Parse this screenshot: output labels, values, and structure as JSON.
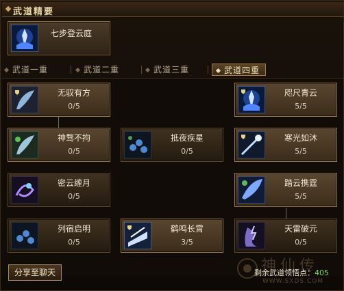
{
  "header": {
    "title": "武道精要"
  },
  "essence": {
    "label": "七步登云庭",
    "icon": "lotus-warrior-icon"
  },
  "tabs": [
    {
      "label": "武道一重",
      "active": false
    },
    {
      "label": "武道二重",
      "active": false
    },
    {
      "label": "武道三重",
      "active": false
    },
    {
      "label": "武道四重",
      "active": true
    }
  ],
  "nodes": [
    {
      "name": "无驭有方",
      "progress": "0/5",
      "icon": "feather-wing-icon",
      "lit": true
    },
    {
      "name": "咫尺青云",
      "progress": "5/5",
      "icon": "lotus-warrior-icon",
      "lit": true
    },
    {
      "name": "神骛不拘",
      "progress": "0/5",
      "icon": "feather-wing-icon",
      "lit": true
    },
    {
      "name": "抵夜疾星",
      "progress": "0/5",
      "icon": "triple-orb-icon",
      "lit": false
    },
    {
      "name": "寒光如沐",
      "progress": "5/5",
      "icon": "shooting-star-icon",
      "lit": true
    },
    {
      "name": "密云缠月",
      "progress": "0/5",
      "icon": "swirl-moon-icon",
      "lit": false
    },
    {
      "name": "踏云携霆",
      "progress": "5/5",
      "icon": "cloud-wing-icon",
      "lit": true
    },
    {
      "name": "列宿启明",
      "progress": "0/5",
      "icon": "triple-orb-icon",
      "lit": false
    },
    {
      "name": "鹤鸣长霄",
      "progress": "3/5",
      "icon": "crane-claw-icon",
      "lit": true
    },
    {
      "name": "天雷破元",
      "progress": "0/5",
      "icon": "thunder-figure-icon",
      "lit": false
    }
  ],
  "share_button": "分享至聊天",
  "points": {
    "label": "剩余武道领悟点：",
    "value": "405"
  },
  "watermark": {
    "text": "神仙传",
    "url": "WWW.SXDS.COM"
  },
  "colors": {
    "accent_gold": "#c9a66b",
    "points_green": "#7ed957",
    "link_gray": "#6e6e6e"
  }
}
